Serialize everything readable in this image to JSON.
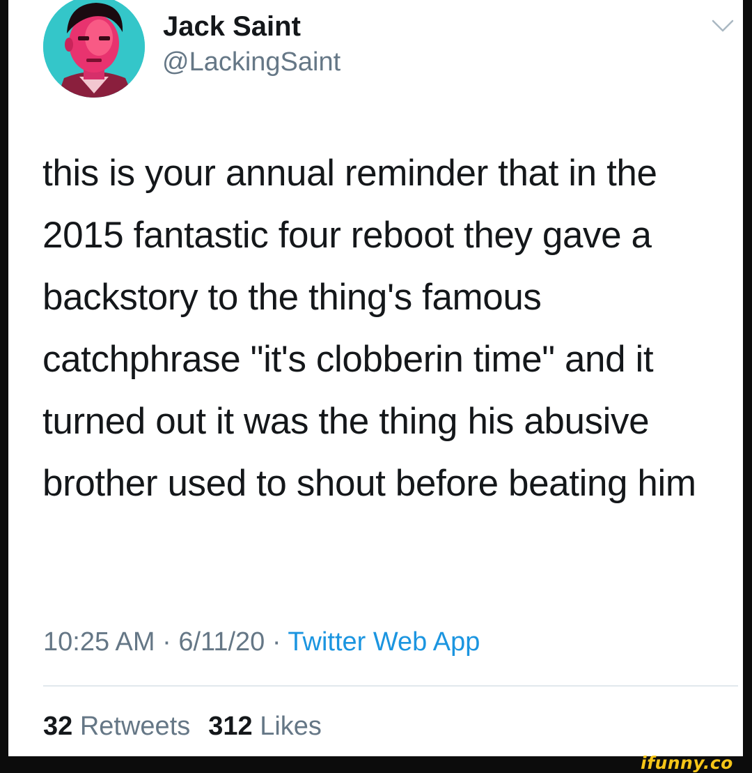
{
  "tweet": {
    "author": {
      "display_name": "Jack Saint",
      "handle": "@LackingSaint"
    },
    "text": "this is your annual reminder that in the 2015 fantastic four reboot they gave a backstory to the thing's famous catchphrase \"it's clobberin time\" and it turned out it was the thing his abusive brother used to shout before beating him",
    "meta": {
      "time": "10:25 AM",
      "separator": " · ",
      "date": "6/11/20",
      "source": "Twitter Web App"
    },
    "stats": {
      "retweets_count": "32",
      "retweets_label": "Retweets",
      "likes_count": "312",
      "likes_label": "Likes"
    },
    "menu_icon": "chevron-down-icon"
  },
  "watermark": "ifunny.co",
  "colors": {
    "background": "#0c0c0c",
    "card": "#ffffff",
    "text_primary": "#14171a",
    "text_secondary": "#657786",
    "link": "#1b95e0",
    "divider": "#e1e8ed",
    "watermark": "#f5c518"
  }
}
